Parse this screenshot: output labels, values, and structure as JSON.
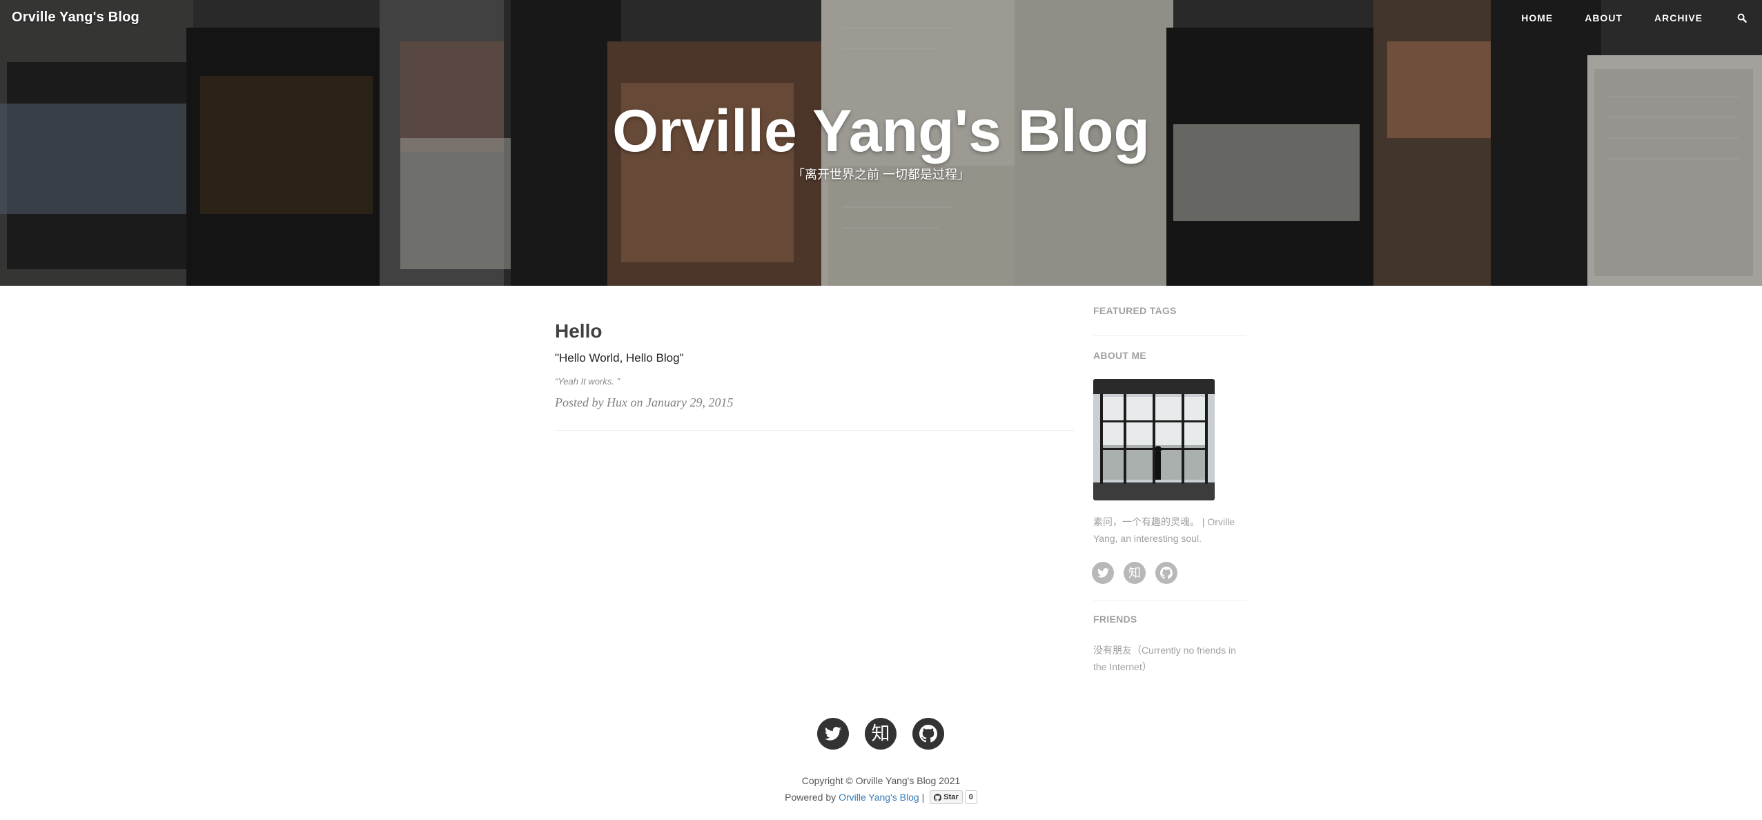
{
  "site": {
    "brand": "Orville Yang's Blog",
    "nav": [
      "HOME",
      "ABOUT",
      "ARCHIVE"
    ],
    "hero_title": "Orville Yang's Blog",
    "hero_subtitle": "「离开世界之前 一切都是过程」"
  },
  "post": {
    "title": "Hello",
    "subtitle": "\"Hello World, Hello Blog\"",
    "excerpt": "“Yeah It works. ”",
    "meta": "Posted by Hux on January 29, 2015"
  },
  "sidebar": {
    "featured_tags_heading": "FEATURED TAGS",
    "about_heading": "ABOUT ME",
    "about_text": "素问，一个有趣的灵魂。 | Orville Yang, an interesting soul.",
    "friends_heading": "FRIENDS",
    "friends_text": "没有朋友（Currently no friends in the Internet）",
    "social": [
      {
        "icon": "twitter-icon",
        "glyph": ""
      },
      {
        "icon": "zhihu-icon",
        "glyph": "知"
      },
      {
        "icon": "github-icon",
        "glyph": ""
      }
    ]
  },
  "footer": {
    "zhihu_glyph": "知",
    "copyright": "Copyright © Orville Yang's Blog 2021",
    "powered_prefix": "Powered by",
    "powered_link": "Orville Yang's Blog",
    "separator": "|",
    "star_label": "Star",
    "star_count": "0"
  },
  "colors": {
    "link": "#337ab7",
    "footer_icon_bg": "#333333",
    "sidebar_icon_bg": "#b8b8b8"
  }
}
